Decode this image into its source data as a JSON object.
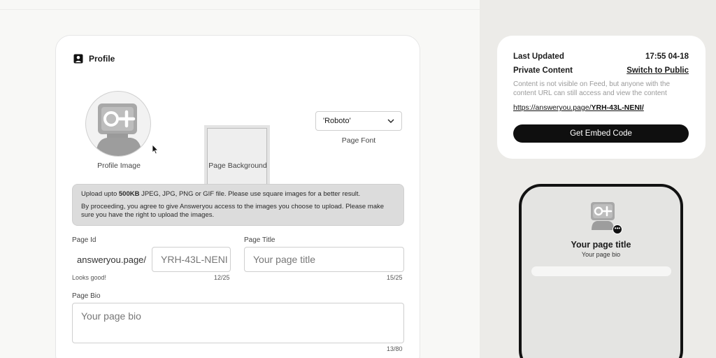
{
  "profile": {
    "title": "Profile",
    "profile_image_label": "Profile Image",
    "page_background_label": "Page Background",
    "font_value": "'Roboto'",
    "font_label": "Page Font"
  },
  "notice": {
    "line1_pre": "Upload upto ",
    "line1_bold": "500KB",
    "line1_post": " JPEG, JPG, PNG or GIF file. Please use square images for a better result.",
    "line2": "By proceeding, you agree to give Answeryou access to the images you choose to upload. Please make sure you have the right to upload the images."
  },
  "form": {
    "page_id_label": "Page Id",
    "page_id_prefix": "answeryou.page/",
    "page_id_value": "YRH-43L-NENI",
    "page_id_status": "Looks good!",
    "page_id_count": "12/25",
    "page_title_label": "Page Title",
    "page_title_placeholder": "Your page title",
    "page_title_count": "15/25",
    "page_bio_label": "Page Bio",
    "page_bio_placeholder": "Your page bio",
    "page_bio_count": "13/80"
  },
  "info": {
    "last_updated_label": "Last Updated",
    "last_updated_value": "17:55 04-18",
    "private_label": "Private Content",
    "switch_label": "Switch to Public",
    "description": "Content is not visible on Feed, but anyone with the content URL can still access and view the content",
    "url_base": "https://answeryou.page/",
    "url_id": "YRH-43L-NENI/",
    "embed_label": "Get Embed Code"
  },
  "preview": {
    "title": "Your page title",
    "bio": "Your page bio"
  },
  "icons": {
    "profile": "person-badge-icon",
    "chevron": "chevron-down-icon",
    "avatar": "robot-avatar-icon",
    "more": "more-dots-icon",
    "cursor": "mouse-cursor-icon"
  },
  "colors": {
    "accent": "#0f0f0f",
    "panel": "#ecebe8",
    "notice": "#dcdcdc"
  }
}
